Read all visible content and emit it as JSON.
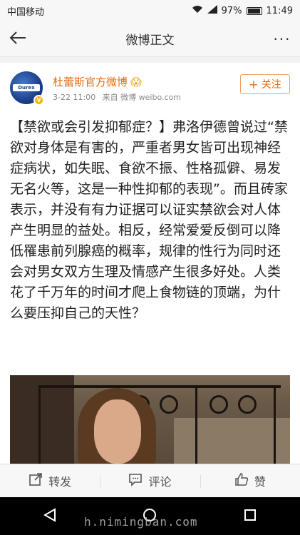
{
  "status_bar": {
    "carrier": "中国移动",
    "battery": "97%",
    "time": "11:49",
    "icons": [
      "wifi-icon",
      "signal-icon",
      "battery-icon"
    ]
  },
  "nav": {
    "title": "微博正文",
    "back_icon": "back-arrow-icon",
    "more_label": "···"
  },
  "post": {
    "username": "杜蕾斯官方微博",
    "username_emoji": "😱",
    "date": "3-22 11:00",
    "source": "来自 微博 weibo.com",
    "follow_label": "关注",
    "text": "【禁欲或会引发抑郁症？】弗洛伊德曾说过“禁欲对身体是有害的，严重者男女皆可出现神经症病状，如失眠、食欲不振、性格孤僻、易发无名火等，这是一种性抑郁的表现”。而且砖家表示，并没有有力证据可以证实禁欲会对人体产生明显的益处。相反，经常爱爱反倒可以降低罹患前列腺癌的概率，规律的性行为同时还会对男女双方生理及情感产生很多好处。人类花了千万年的时间才爬上食物链的顶端，为什么要压抑自己的天性？"
  },
  "actions": {
    "repost_label": "转发",
    "comment_label": "评论",
    "like_label": "赞"
  },
  "watermark": {
    "text": "h.nimingban.com"
  },
  "colors": {
    "accent": "#e86b0e",
    "verified": "#f6b400"
  }
}
